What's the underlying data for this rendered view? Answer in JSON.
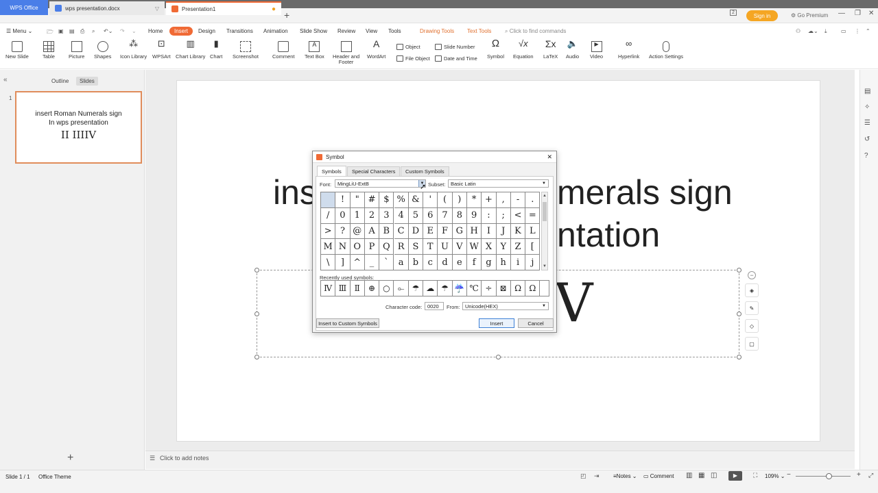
{
  "tabs": {
    "wps": "WPS Office",
    "doc": "wps presentation.docx",
    "ppt": "Presentation1"
  },
  "account": {
    "signin": "Sign in",
    "premium": "Go Premium"
  },
  "menu": {
    "menu_label": "Menu",
    "items": [
      "Home",
      "Insert",
      "Design",
      "Transitions",
      "Animation",
      "Slide Show",
      "Review",
      "View",
      "Tools",
      "Drawing Tools",
      "Text Tools"
    ],
    "search_placeholder": "Click to find commands"
  },
  "ribbon": {
    "new_slide": "New Slide",
    "table": "Table",
    "picture": "Picture",
    "shapes": "Shapes",
    "icon_library": "Icon Library",
    "wpsart": "WPSArt",
    "chart_library": "Chart Library",
    "chart": "Chart",
    "screenshot": "Screenshot",
    "comment": "Comment",
    "text_box": "Text Box",
    "header_footer_1": "Header and",
    "header_footer_2": "Footer",
    "wordart": "WordArt",
    "object": "Object",
    "file_object": "File Object",
    "slide_number": "Slide Number",
    "date_time": "Date and Time",
    "symbol": "Symbol",
    "equation": "Equation",
    "latex": "LaTeX",
    "audio": "Audio",
    "video": "Video",
    "hyperlink": "Hyperlink",
    "action_settings": "Action Settings"
  },
  "leftpane": {
    "outline_tab": "Outline",
    "slides_tab": "Slides",
    "slide_number": "1",
    "thumb_line1": "insert  Roman Numerals sign",
    "thumb_line2": "In wps presentation",
    "thumb_line3": "II IIIIV",
    "add": "+"
  },
  "slide": {
    "title_line1_left": "ins",
    "title_line1_right": "merals sign",
    "title_line2_right": "ntation",
    "numeral_visible": "V"
  },
  "notes": {
    "placeholder": "Click to add notes"
  },
  "status": {
    "slide_count": "Slide 1 / 1",
    "theme": "Office Theme",
    "notes": "Notes",
    "comment": "Comment",
    "zoom": "109%"
  },
  "dialog": {
    "title": "Symbol",
    "tabs": [
      "Symbols",
      "Special Characters",
      "Custom Symbols"
    ],
    "font_label": "Font:",
    "font_value": "MingLiU-ExtB",
    "subset_label": "Subset:",
    "subset_value": "Basic Latin",
    "grid": [
      [
        " ",
        "!",
        "\"",
        "#",
        "$",
        "%",
        "&",
        "'",
        "(",
        ")",
        "*",
        "+",
        ",",
        "-",
        "."
      ],
      [
        "/",
        "0",
        "1",
        "2",
        "3",
        "4",
        "5",
        "6",
        "7",
        "8",
        "9",
        ":",
        ";",
        "<",
        "="
      ],
      [
        ">",
        "?",
        "@",
        "A",
        "B",
        "C",
        "D",
        "E",
        "F",
        "G",
        "H",
        "I",
        "J",
        "K",
        "L"
      ],
      [
        "M",
        "N",
        "O",
        "P",
        "Q",
        "R",
        "S",
        "T",
        "U",
        "V",
        "W",
        "X",
        "Y",
        "Z",
        "["
      ],
      [
        "\\",
        "]",
        "^",
        "_",
        "`",
        "a",
        "b",
        "c",
        "d",
        "e",
        "f",
        "g",
        "h",
        "i",
        "j"
      ]
    ],
    "recent_label": "Recently used symbols:",
    "recent": [
      "Ⅳ",
      "Ⅲ",
      "Ⅱ",
      "⊕",
      "○",
      "⟜",
      "☂",
      "☁",
      "☂",
      "☔",
      "℃",
      "÷",
      "⊠",
      "Ω",
      "Ω"
    ],
    "char_code_label": "Character code:",
    "char_code_value": "0020",
    "from_label": "From:",
    "from_value": "Unicode(HEX)",
    "insert_custom": "Insert to Custom Symbols",
    "insert": "Insert",
    "cancel": "Cancel",
    "close": "✕"
  },
  "colors": {
    "accent": "#f06a35",
    "wps_blue": "#4a7ee8",
    "selection": "#cfdcec"
  }
}
